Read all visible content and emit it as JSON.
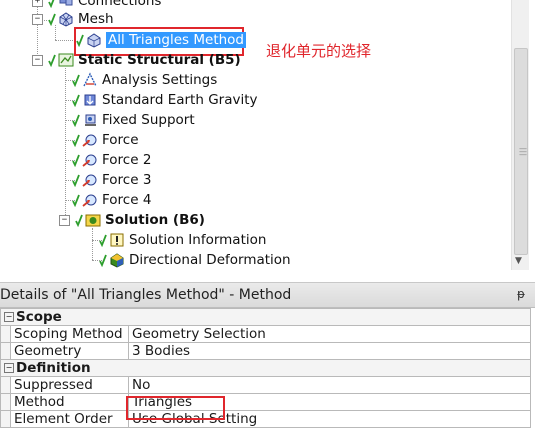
{
  "tree": {
    "connections_label": "Connections",
    "mesh_label": "Mesh",
    "mesh_method_label": "All Triangles Method",
    "static_structural_label": "Static Structural (B5)",
    "items": [
      {
        "label": "Analysis Settings",
        "icon": "analysis-settings-icon"
      },
      {
        "label": "Standard Earth Gravity",
        "icon": "gravity-icon"
      },
      {
        "label": "Fixed Support",
        "icon": "fixed-support-icon"
      },
      {
        "label": "Force",
        "icon": "force-icon"
      },
      {
        "label": "Force 2",
        "icon": "force-icon"
      },
      {
        "label": "Force 3",
        "icon": "force-icon"
      },
      {
        "label": "Force 4",
        "icon": "force-icon"
      }
    ],
    "solution_label": "Solution (B6)",
    "solution_items": [
      {
        "label": "Solution Information",
        "icon": "solution-information-icon"
      },
      {
        "label": "Directional Deformation",
        "icon": "directional-deformation-icon"
      }
    ]
  },
  "annotation": "退化单元的选择",
  "details": {
    "title": "Details of \"All Triangles Method\" - Method",
    "pin": "ᵽ",
    "groups": [
      {
        "name": "Scope",
        "rows": [
          {
            "key": "Scoping Method",
            "value": "Geometry Selection"
          },
          {
            "key": "Geometry",
            "value": "3 Bodies"
          }
        ]
      },
      {
        "name": "Definition",
        "rows": [
          {
            "key": "Suppressed",
            "value": "No"
          },
          {
            "key": "Method",
            "value": "Triangles"
          },
          {
            "key": "Element Order",
            "value": "Use Global Setting"
          }
        ]
      }
    ]
  },
  "colors": {
    "selection": "#3399ff",
    "annotation_red": "#e0262c",
    "check_green": "#2e9e2e"
  }
}
